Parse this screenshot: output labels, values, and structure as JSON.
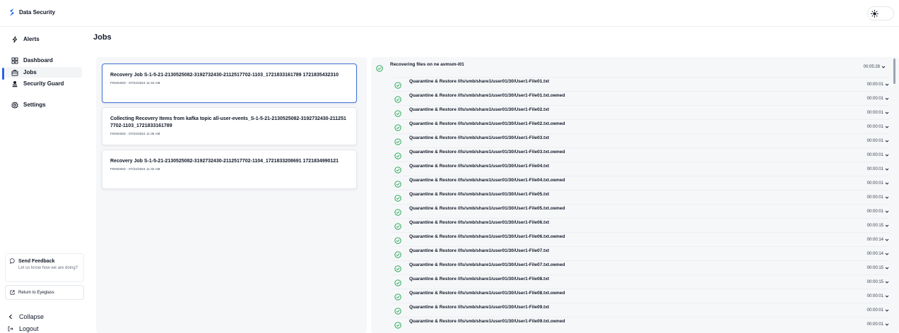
{
  "app": {
    "title": "Data Security",
    "accent": "#2563eb",
    "success": "#16a34a"
  },
  "sidebar": {
    "items": [
      {
        "label": "Alerts",
        "icon": "alerts-icon"
      },
      {
        "label": "Dashboard",
        "icon": "dashboard-icon"
      },
      {
        "label": "Jobs",
        "icon": "jobs-icon",
        "active": true
      },
      {
        "label": "Security Guard",
        "icon": "security-guard-icon"
      },
      {
        "label": "Settings",
        "icon": "settings-icon"
      }
    ],
    "feedback": {
      "title": "Send Feedback",
      "subtitle": "Let us know how we are doing?"
    },
    "return_label": "Return to Eyeglass",
    "collapse_label": "Collapse",
    "logout_label": "Logout"
  },
  "main": {
    "title": "Jobs",
    "jobs": [
      {
        "name": "Recovery Job S-1-5-21-2130525082-3192732430-2112517702-1103_1721833161789 1721835432310",
        "status": "FINISHED - 07/24/2024 11:42 AM",
        "selected": true
      },
      {
        "name": "Collecting Recovery Items from kafka topic all-user-events_S-1-5-21-2130525082-3192732430-2112517702-1103_1721833161789",
        "status": "FINISHED - 07/24/2024 11:35 AM",
        "selected": false
      },
      {
        "name": "Recovery Job S-1-5-21-2130525082-3192732430-2112517702-1104_1721833208691 1721834990121",
        "status": "FINISHED - 07/24/2024 11:32 AM",
        "selected": false
      }
    ],
    "detail": {
      "root": {
        "label": "Recovering files on ne avmsm-i01",
        "time": "00:05:28"
      },
      "steps": [
        {
          "label": "Quarantine & Restore /ifs/smb/share1/user01/30/User1-File01.txt",
          "time": "00:00:01"
        },
        {
          "label": "Quarantine & Restore /ifs/smb/share1/user01/30/User1-File01.txt.owned",
          "time": "00:00:01"
        },
        {
          "label": "Quarantine & Restore /ifs/smb/share1/user01/30/User1-File02.txt",
          "time": "00:00:01"
        },
        {
          "label": "Quarantine & Restore /ifs/smb/share1/user01/30/User1-File02.txt.owned",
          "time": "00:00:01"
        },
        {
          "label": "Quarantine & Restore /ifs/smb/share1/user01/30/User1-File03.txt",
          "time": "00:00:01"
        },
        {
          "label": "Quarantine & Restore /ifs/smb/share1/user01/30/User1-File03.txt.owned",
          "time": "00:00:01"
        },
        {
          "label": "Quarantine & Restore /ifs/smb/share1/user01/30/User1-File04.txt",
          "time": "00:00:01"
        },
        {
          "label": "Quarantine & Restore /ifs/smb/share1/user01/30/User1-File04.txt.owned",
          "time": "00:00:01"
        },
        {
          "label": "Quarantine & Restore /ifs/smb/share1/user01/30/User1-File05.txt",
          "time": "00:00:01"
        },
        {
          "label": "Quarantine & Restore /ifs/smb/share1/user01/30/User1-File05.txt.owned",
          "time": "00:00:01"
        },
        {
          "label": "Quarantine & Restore /ifs/smb/share1/user01/30/User1-File06.txt",
          "time": "00:00:15"
        },
        {
          "label": "Quarantine & Restore /ifs/smb/share1/user01/30/User1-File06.txt.owned",
          "time": "00:00:14"
        },
        {
          "label": "Quarantine & Restore /ifs/smb/share1/user01/30/User1-File07.txt",
          "time": "00:00:14"
        },
        {
          "label": "Quarantine & Restore /ifs/smb/share1/user01/30/User1-File07.txt.owned",
          "time": "00:00:15"
        },
        {
          "label": "Quarantine & Restore /ifs/smb/share1/user01/30/User1-File08.txt",
          "time": "00:00:15"
        },
        {
          "label": "Quarantine & Restore /ifs/smb/share1/user01/30/User1-File08.txt.owned",
          "time": "00:00:01"
        },
        {
          "label": "Quarantine & Restore /ifs/smb/share1/user01/30/User1-File09.txt",
          "time": "00:00:01"
        },
        {
          "label": "Quarantine & Restore /ifs/smb/share1/user01/30/User1-File09.txt.owned",
          "time": "00:00:01"
        }
      ]
    }
  }
}
